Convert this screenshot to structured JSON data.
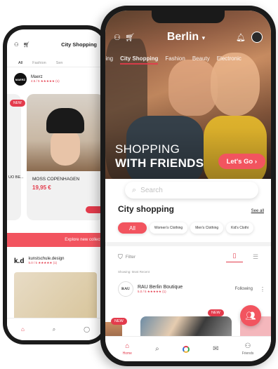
{
  "back_phone": {
    "header_title": "City Shopping",
    "tabs": [
      "All",
      "Fashion",
      "Sen"
    ],
    "shop1": {
      "logo": "MAERZ",
      "name": "Maerz",
      "rating": "4.5 / 5 ★★★★★ (1)"
    },
    "badge_new": "NEW",
    "left_product_text": "UO BE...",
    "product": {
      "name": "MOSS COPENHAGEN",
      "price": "19,95 €"
    },
    "explore_label": "Explore new collect",
    "shop2": {
      "logo": "k.d",
      "name": "kunstschule.design",
      "rating": "5.0 / 5 ★★★★★ (1)"
    },
    "nav_label": "Home"
  },
  "front_phone": {
    "city": "Berlin",
    "categories": [
      "ping",
      "City Shopping",
      "Fashion",
      "Beauty",
      "Electronic"
    ],
    "hero_line1": "SHOPPING",
    "hero_line2": "WITH FRIENDS",
    "cta": "Let's Go ›",
    "search_placeholder": "Search",
    "section_title": "City shopping",
    "see_all": "See all",
    "chips": [
      "All",
      "Women's Clothing",
      "Men's Clothing",
      "Kid's Clothi"
    ],
    "filter_label": "Filter",
    "sort_text": "Showing: Most Recent",
    "store": {
      "logo": "RAU",
      "name": "RAU Berlin Boutique",
      "rating": "5.0 / 5 ★★★★★ (1)",
      "follow": "Following"
    },
    "badge_new_1": "NEW",
    "badge_new_2": "NEW",
    "nav": [
      "Home",
      "",
      "",
      "",
      "Friends"
    ]
  },
  "colors": {
    "accent": "#f2545f",
    "accent_dark": "#e33b4c"
  }
}
